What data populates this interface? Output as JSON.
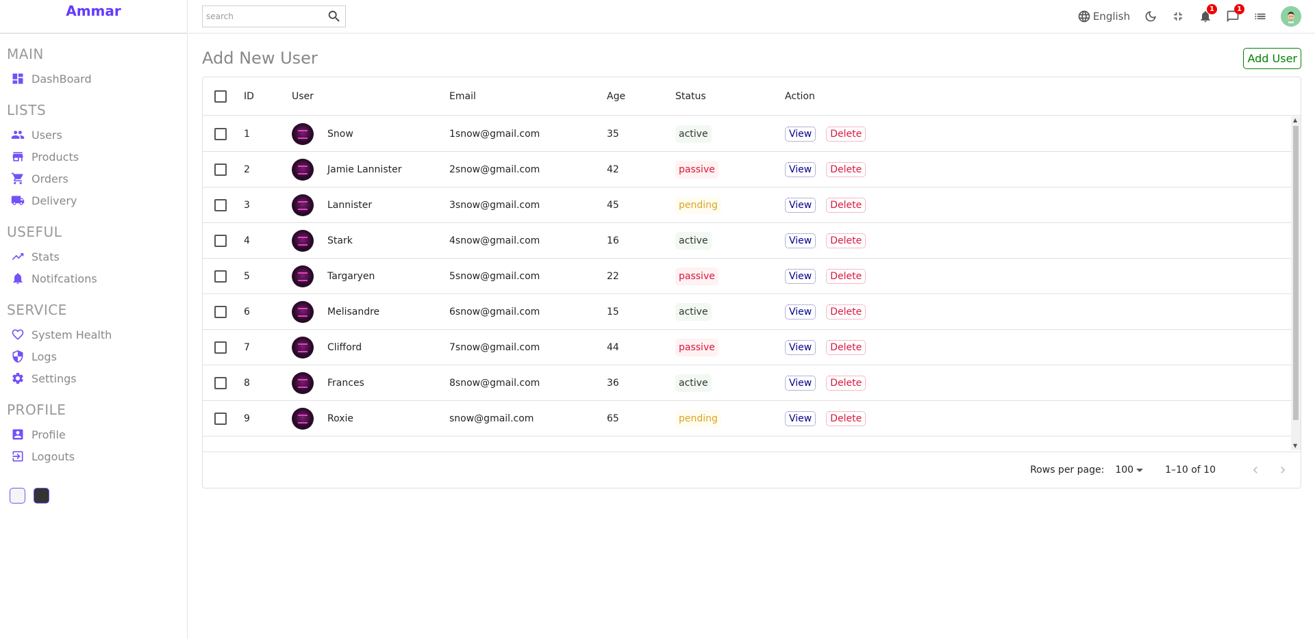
{
  "app": {
    "brand": "Ammar"
  },
  "sidebar": {
    "sections": [
      {
        "title": "MAIN",
        "items": [
          {
            "label": "DashBoard",
            "icon": "dashboard-icon"
          }
        ]
      },
      {
        "title": "LISTS",
        "items": [
          {
            "label": "Users",
            "icon": "users-icon"
          },
          {
            "label": "Products",
            "icon": "store-icon"
          },
          {
            "label": "Orders",
            "icon": "cart-icon"
          },
          {
            "label": "Delivery",
            "icon": "truck-icon"
          }
        ]
      },
      {
        "title": "USEFUL",
        "items": [
          {
            "label": "Stats",
            "icon": "trending-up-icon"
          },
          {
            "label": "Notifcations",
            "icon": "bell-icon"
          }
        ]
      },
      {
        "title": "SERVICE",
        "items": [
          {
            "label": "System Health",
            "icon": "heart-icon"
          },
          {
            "label": "Logs",
            "icon": "shield-icon"
          },
          {
            "label": "Settings",
            "icon": "gear-icon"
          }
        ]
      },
      {
        "title": "PROFILE",
        "items": [
          {
            "label": "Profile",
            "icon": "account-box-icon"
          },
          {
            "label": "Logouts",
            "icon": "logout-icon"
          }
        ]
      }
    ],
    "theme_options": [
      "light",
      "dark"
    ]
  },
  "navbar": {
    "search_placeholder": "search",
    "language": "English",
    "notifications_count": "1",
    "messages_count": "1"
  },
  "main": {
    "title": "Add New User",
    "add_button": "Add User"
  },
  "table": {
    "columns": [
      "ID",
      "User",
      "Email",
      "Age",
      "Status",
      "Action"
    ],
    "rows": [
      {
        "id": "1",
        "user": "Snow",
        "email": "1snow@gmail.com",
        "age": "35",
        "status": "active"
      },
      {
        "id": "2",
        "user": "Jamie Lannister",
        "email": "2snow@gmail.com",
        "age": "42",
        "status": "passive"
      },
      {
        "id": "3",
        "user": "Lannister",
        "email": "3snow@gmail.com",
        "age": "45",
        "status": "pending"
      },
      {
        "id": "4",
        "user": "Stark",
        "email": "4snow@gmail.com",
        "age": "16",
        "status": "active"
      },
      {
        "id": "5",
        "user": "Targaryen",
        "email": "5snow@gmail.com",
        "age": "22",
        "status": "passive"
      },
      {
        "id": "6",
        "user": "Melisandre",
        "email": "6snow@gmail.com",
        "age": "15",
        "status": "active"
      },
      {
        "id": "7",
        "user": "Clifford",
        "email": "7snow@gmail.com",
        "age": "44",
        "status": "passive"
      },
      {
        "id": "8",
        "user": "Frances",
        "email": "8snow@gmail.com",
        "age": "36",
        "status": "active"
      },
      {
        "id": "9",
        "user": "Roxie",
        "email": "snow@gmail.com",
        "age": "65",
        "status": "pending"
      }
    ],
    "view_label": "View",
    "delete_label": "Delete",
    "footer": {
      "rows_per_page_label": "Rows per page:",
      "rows_per_page_value": "100",
      "range": "1–10 of 10"
    }
  },
  "colors": {
    "accent": "#7451f8",
    "brand": "#6439ff",
    "add_button": "#008000",
    "passive": "#dc143c",
    "pending": "#daa520"
  }
}
